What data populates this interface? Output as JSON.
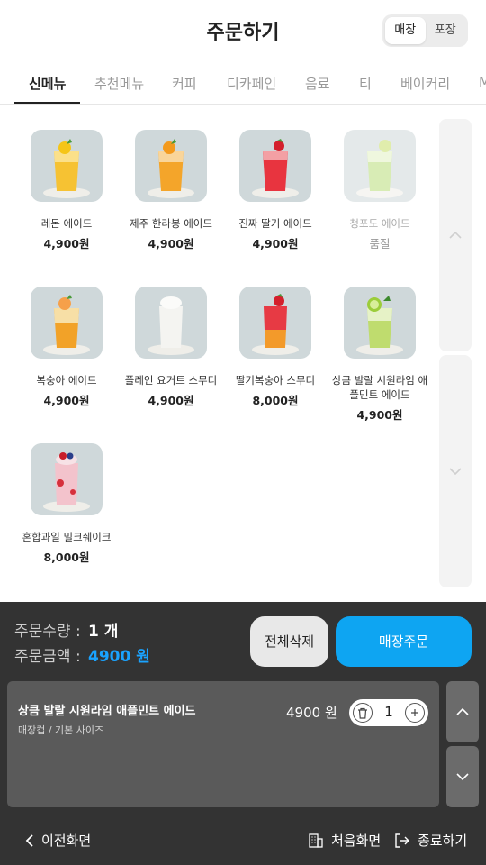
{
  "header": {
    "title": "주문하기",
    "mode_options": [
      "매장",
      "포장"
    ],
    "selected_mode": "매장"
  },
  "tabs": [
    "신메뉴",
    "추천메뉴",
    "커피",
    "디카페인",
    "음료",
    "티",
    "베이커리",
    "M"
  ],
  "active_tab": "신메뉴",
  "menu_items": [
    {
      "name": "레몬 에이드",
      "price": "4,900원",
      "sold_out": false,
      "icon": "lemon-ade-image"
    },
    {
      "name": "제주 한라봉 에이드",
      "price": "4,900원",
      "sold_out": false,
      "icon": "hallabong-ade-image"
    },
    {
      "name": "진짜 딸기 에이드",
      "price": "4,900원",
      "sold_out": false,
      "icon": "strawberry-ade-image"
    },
    {
      "name": "청포도 에이드",
      "price": "품절",
      "sold_out": true,
      "icon": "green-grape-ade-image"
    },
    {
      "name": "복숭아 에이드",
      "price": "4,900원",
      "sold_out": false,
      "icon": "peach-ade-image"
    },
    {
      "name": "플레인 요거트 스무디",
      "price": "4,900원",
      "sold_out": false,
      "icon": "yogurt-smoothie-image"
    },
    {
      "name": "딸기복숭아 스무디",
      "price": "8,000원",
      "sold_out": false,
      "icon": "strawberry-peach-smoothie-image"
    },
    {
      "name": "상큼 발랄 시원라임 애플민트 에이드",
      "price": "4,900원",
      "sold_out": false,
      "icon": "lime-applemint-ade-image"
    },
    {
      "name": "혼합과일 밀크쉐이크",
      "price": "8,000원",
      "sold_out": false,
      "icon": "mixed-fruit-milkshake-image"
    }
  ],
  "summary": {
    "qty_label": "주문수량 :",
    "qty_value": "1 개",
    "amount_label": "주문금액 :",
    "amount_value": "4900 원",
    "clear_button": "전체삭제",
    "order_button": "매장주문",
    "accent_color": "#0ea5f2"
  },
  "cart": [
    {
      "name": "상큼 발랄 시원라임 애플민트 에이드",
      "option": "매장컵 / 기본 사이즈",
      "price": "4900 원",
      "quantity": "1"
    }
  ],
  "nav": {
    "back": "이전화면",
    "home": "처음화면",
    "exit": "종료하기"
  }
}
